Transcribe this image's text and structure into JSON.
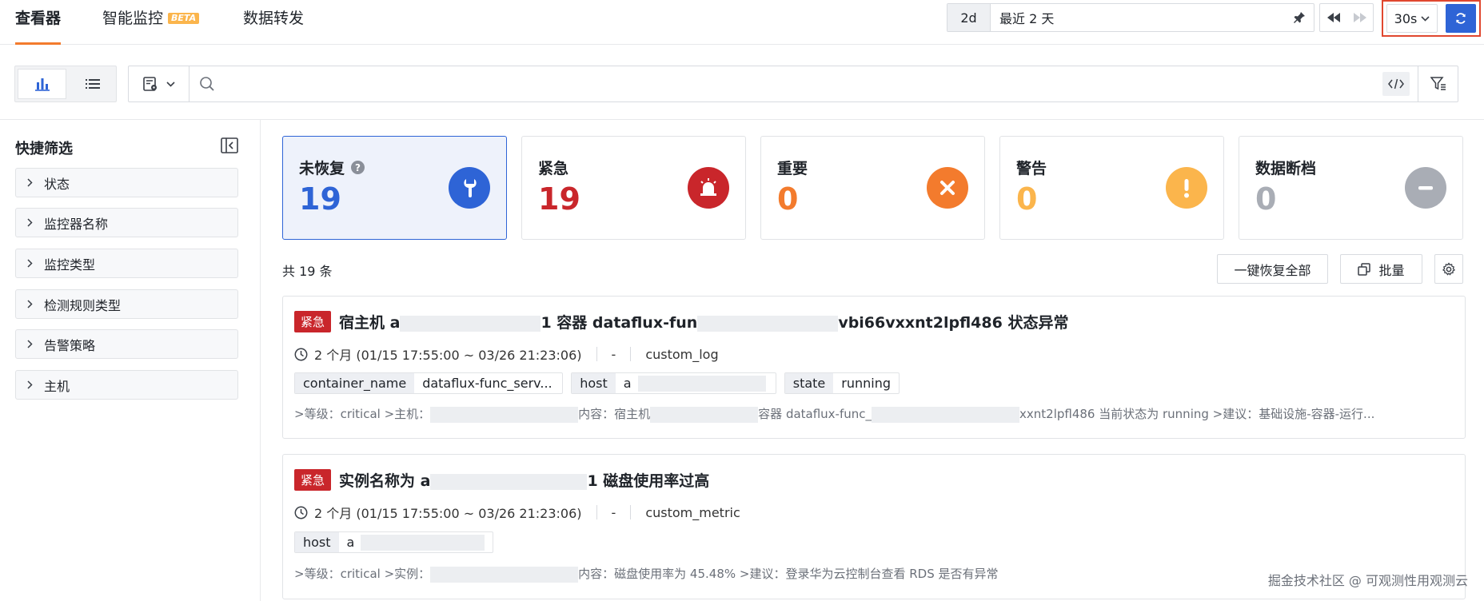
{
  "tabs": [
    {
      "label": "查看器"
    },
    {
      "label": "智能监控",
      "badge": "BETA"
    },
    {
      "label": "数据转发"
    }
  ],
  "time": {
    "relative": "2d",
    "label": "最近 2 天",
    "interval": "30s"
  },
  "search": {
    "placeholder": ""
  },
  "sidebar": {
    "title": "快捷筛选",
    "items": [
      {
        "label": "状态"
      },
      {
        "label": "监控器名称"
      },
      {
        "label": "监控类型"
      },
      {
        "label": "检测规则类型"
      },
      {
        "label": "告警策略"
      },
      {
        "label": "主机"
      }
    ]
  },
  "stats": [
    {
      "label": "未恢复",
      "value": "19",
      "color": "#2e64d6",
      "icon": "wrench-icon"
    },
    {
      "label": "紧急",
      "value": "19",
      "color": "#c9262b",
      "icon": "siren-icon"
    },
    {
      "label": "重要",
      "value": "0",
      "color": "#f37b2d",
      "icon": "x-circle-icon"
    },
    {
      "label": "警告",
      "value": "0",
      "color": "#fbb54c",
      "icon": "exclamation-icon"
    },
    {
      "label": "数据断档",
      "value": "0",
      "color": "#a9adb5",
      "icon": "minus-circle-icon"
    }
  ],
  "list": {
    "total": "共 19 条",
    "recover_all": "一键恢复全部",
    "batch": "批量"
  },
  "events": [
    {
      "badge": "紧急",
      "title_a": "宿主机 a",
      "title_b": "1 容器 dataflux-fun",
      "title_c": "vbi66vxxnt2lpfl486 状态异常",
      "duration": "2 个月 (01/15 17:55:00 ~ 03/26 21:23:06)",
      "dash": "-",
      "source": "custom_log",
      "tags": [
        {
          "k": "container_name",
          "v": "dataflux-func_serv..."
        },
        {
          "k": "host",
          "v": "a"
        },
        {
          "k": "state",
          "v": "running"
        }
      ],
      "desc_a": ">等级：critical >主机：",
      "desc_b": "内容：宿主机",
      "desc_c": "容器 dataflux-func_",
      "desc_d": "xxnt2lpfl486 当前状态为 running >建议：基础设施-容器-运行..."
    },
    {
      "badge": "紧急",
      "title_a": "实例名称为 a",
      "title_b": "1 磁盘使用率过高",
      "duration": "2 个月 (01/15 17:55:00 ~ 03/26 21:23:06)",
      "dash": "-",
      "source": "custom_metric",
      "tags": [
        {
          "k": "host",
          "v": "a"
        }
      ],
      "desc_a": ">等级：critical >实例：",
      "desc_b": "内容：磁盘使用率为 45.48% >建议：登录华为云控制台查看 RDS 是否有异常"
    }
  ],
  "watermark": "掘金技术社区 @ 可观测性用观测云"
}
